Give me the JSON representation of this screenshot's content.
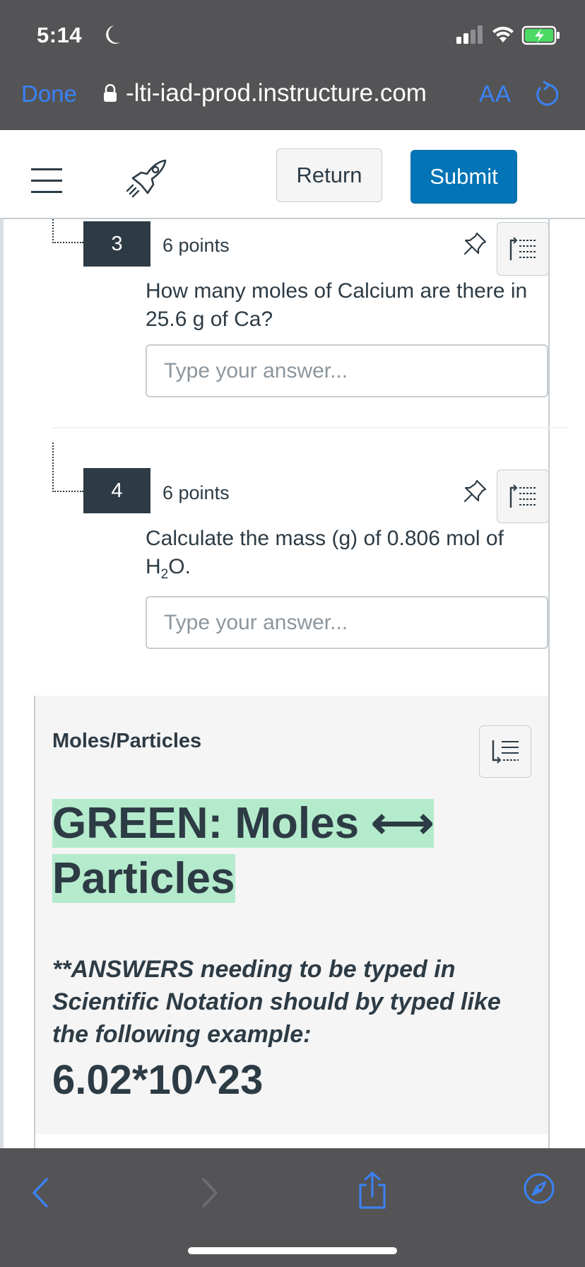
{
  "status_bar": {
    "time": "5:14"
  },
  "browser": {
    "done_label": "Done",
    "url": "-lti-iad-prod.instructure.com",
    "text_size_label": "AA"
  },
  "quiz_header": {
    "return_label": "Return",
    "submit_label": "Submit"
  },
  "questions": [
    {
      "number": "3",
      "points": "6 points",
      "text": "How many moles of Calcium are there in 25.6 g of Ca?",
      "answer_placeholder": "Type your answer...",
      "answer_value": ""
    },
    {
      "number": "4",
      "points": "6 points",
      "text_before": "Calculate the mass (g) of 0.806 mol of H",
      "text_sub": "2",
      "text_after": "O.",
      "answer_placeholder": "Type your answer...",
      "answer_value": ""
    }
  ],
  "text_block": {
    "title": "Moles/Particles",
    "heading": "GREEN: Moles ⟷ Particles",
    "highlight_color": "#b4ebcc",
    "note": "**ANSWERS needing to be typed in Scientific Notation should by typed like the following example:",
    "example": "6.02*10^23"
  },
  "colors": {
    "ios_blue": "#3a82f7",
    "canvas_submit": "#0374b5",
    "canvas_text": "#2d3b45",
    "chrome_gray": "#545456"
  },
  "icons": {
    "toolbar": [
      "back-icon",
      "forward-icon",
      "share-icon",
      "compass-icon"
    ]
  }
}
